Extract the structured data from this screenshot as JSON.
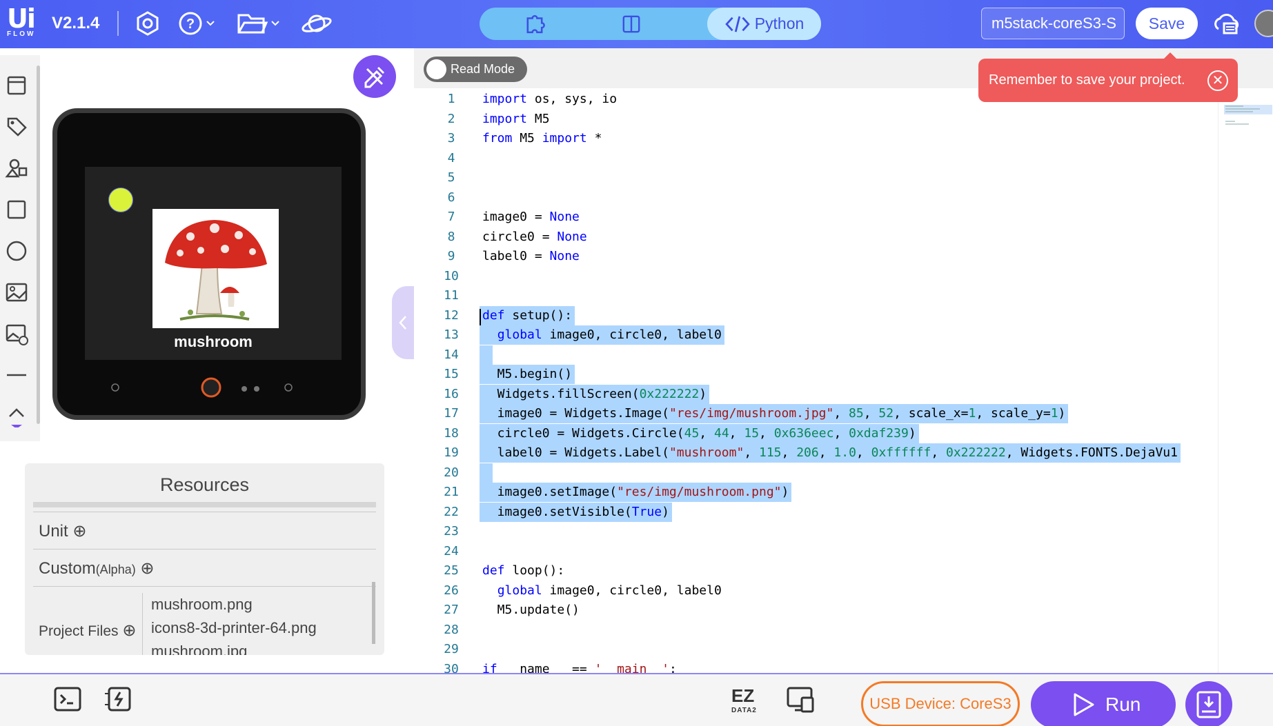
{
  "header": {
    "version": "V2.1.4",
    "python_label": "Python",
    "device_name": "m5stack-coreS3-S",
    "save_label": "Save"
  },
  "device": {
    "screen_label": "mushroom"
  },
  "read_mode_label": "Read Mode",
  "toast_message": "Remember to save your project.",
  "resources": {
    "title": "Resources",
    "unit_label": "Unit",
    "custom_label": "Custom",
    "custom_tag": "(Alpha)",
    "project_files_label": "Project Files",
    "files": [
      "mushroom.png",
      "icons8-3d-printer-64.png",
      "mushroom.jpg"
    ]
  },
  "code_lines": [
    "import os, sys, io",
    "import M5",
    "from M5 import *",
    "",
    "",
    "",
    "image0 = None",
    "circle0 = None",
    "label0 = None",
    "",
    "",
    "def setup():",
    "  global image0, circle0, label0",
    "",
    "  M5.begin()",
    "  Widgets.fillScreen(0x222222)",
    "  image0 = Widgets.Image(\"res/img/mushroom.jpg\", 85, 52, scale_x=1, scale_y=1)",
    "  circle0 = Widgets.Circle(45, 44, 15, 0x636eec, 0xdaf239)",
    "  label0 = Widgets.Label(\"mushroom\", 115, 206, 1.0, 0xffffff, 0x222222, Widgets.FONTS.DejaVu1",
    "",
    "  image0.setImage(\"res/img/mushroom.png\")",
    "  image0.setVisible(True)",
    "",
    "",
    "def loop():",
    "  global image0, circle0, label0",
    "  M5.update()",
    "",
    "",
    "if __name__ == '__main__':"
  ],
  "bottom": {
    "ez_label": "EZ",
    "ez_sub": "DATA2",
    "usb_label": "USB Device: CoreS3",
    "run_label": "Run"
  },
  "colors": {
    "header": "#4b5ff3",
    "accent_purple": "#7b4ff0",
    "toast": "#ef5a5a",
    "usb_orange": "#f47a25",
    "screen_bg": "#222222",
    "circle_fill": "#daf239",
    "selection": "#add6ff"
  }
}
